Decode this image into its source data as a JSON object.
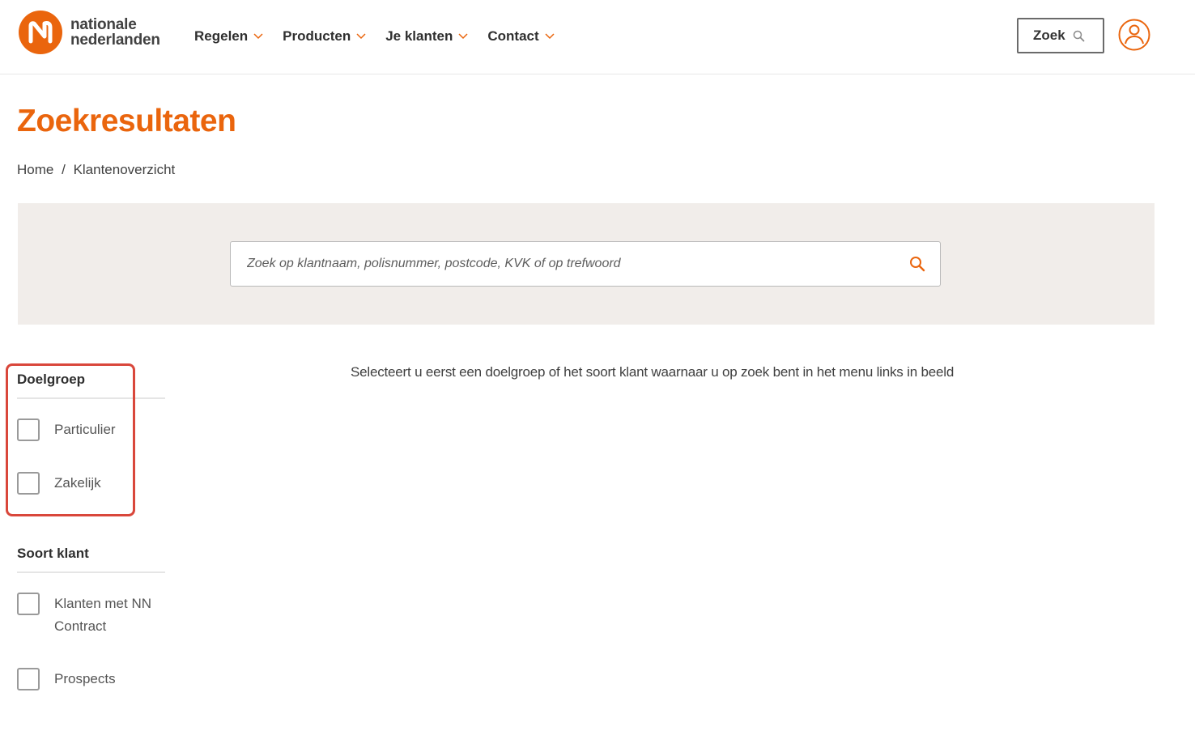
{
  "brand": {
    "line1": "nationale",
    "line2": "nederlanden",
    "accent_color": "#ea650d"
  },
  "nav": {
    "items": [
      {
        "label": "Regelen",
        "icon": "chevron-down-icon"
      },
      {
        "label": "Producten",
        "icon": "chevron-down-icon"
      },
      {
        "label": "Je klanten",
        "icon": "chevron-down-icon"
      },
      {
        "label": "Contact",
        "icon": "chevron-down-icon"
      }
    ],
    "search_button_label": "Zoek",
    "search_button_icon": "search-icon",
    "account_icon": "user-icon"
  },
  "page": {
    "title": "Zoekresultaten",
    "breadcrumb": [
      {
        "label": "Home"
      },
      {
        "label": "Klantenoverzicht"
      }
    ],
    "breadcrumb_separator": "/"
  },
  "search": {
    "value": "",
    "placeholder": "Zoek op klantnaam, polisnummer, postcode, KVK of op trefwoord",
    "icon": "search-icon"
  },
  "filters": {
    "doelgroep": {
      "heading": "Doelgroep",
      "options": [
        {
          "label": "Particulier",
          "checked": false
        },
        {
          "label": "Zakelijk",
          "checked": false
        }
      ]
    },
    "soort_klant": {
      "heading": "Soort klant",
      "options": [
        {
          "label": "Klanten met NN Contract",
          "checked": false
        },
        {
          "label": "Prospects",
          "checked": false
        }
      ]
    },
    "highlight_color": "#d9473b"
  },
  "main": {
    "instruction": "Selecteert u eerst een doelgroep of het soort klant waarnaar u op zoek bent in het menu links in beeld"
  }
}
